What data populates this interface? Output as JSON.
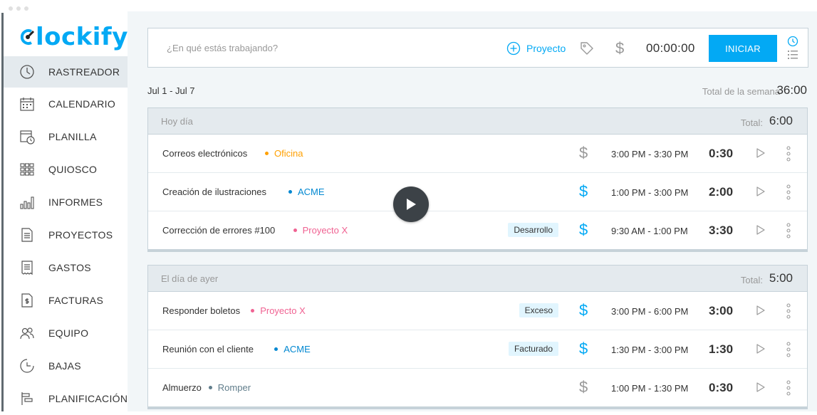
{
  "app": {
    "logo_text": "lockify",
    "brand_color": "#03a9f4"
  },
  "sidebar": {
    "items": [
      {
        "label": "RASTREADOR",
        "icon": "clock-icon",
        "active": true
      },
      {
        "label": "CALENDARIO",
        "icon": "calendar-icon"
      },
      {
        "label": "PLANILLA",
        "icon": "timesheet-icon"
      },
      {
        "label": "QUIOSCO",
        "icon": "kiosk-icon"
      },
      {
        "label": "INFORMES",
        "icon": "reports-icon"
      },
      {
        "label": "PROYECTOS",
        "icon": "projects-icon"
      },
      {
        "label": "GASTOS",
        "icon": "expenses-icon"
      },
      {
        "label": "FACTURAS",
        "icon": "invoices-icon"
      },
      {
        "label": "EQUIPO",
        "icon": "team-icon"
      },
      {
        "label": "BAJAS",
        "icon": "time-off-icon"
      },
      {
        "label": "PLANIFICACIÓN",
        "icon": "schedule-icon"
      }
    ]
  },
  "tracker": {
    "placeholder": "¿En qué estás trabajando?",
    "project_label": "Proyecto",
    "timer": "00:00:00",
    "start_label": "INICIAR"
  },
  "week": {
    "range": "Jul 1 - Jul 7",
    "total_label": "Total de la semana",
    "total_value": "36:00"
  },
  "groups": [
    {
      "title": "Hoy día",
      "total_label": "Total:",
      "total_value": "6:00",
      "entries": [
        {
          "name": "Correos electrónicos",
          "project": "Oficina",
          "project_color": "#ffa000",
          "badge": "",
          "billable": false,
          "range": "3:00 PM - 3:30 PM",
          "duration": "0:30"
        },
        {
          "name": "Creación de ilustraciones",
          "project": "ACME",
          "project_color": "#0288d1",
          "badge": "",
          "billable": true,
          "range": "1:00 PM - 3:00 PM",
          "duration": "2:00"
        },
        {
          "name": "Corrección de errores #100",
          "project": "Proyecto X",
          "project_color": "#f06292",
          "badge": "Desarrollo",
          "billable": true,
          "range": "9:30 AM - 1:00 PM",
          "duration": "3:30"
        }
      ]
    },
    {
      "title": "El día de ayer",
      "total_label": "Total:",
      "total_value": "5:00",
      "entries": [
        {
          "name": "Responder boletos",
          "project": "Proyecto X",
          "project_color": "#f06292",
          "badge": "Exceso",
          "billable": true,
          "range": "3:00 PM - 6:00 PM",
          "duration": "3:00"
        },
        {
          "name": "Reunión con el cliente",
          "project": "ACME",
          "project_color": "#0288d1",
          "badge": "Facturado",
          "billable": true,
          "range": "1:30 PM - 3:00 PM",
          "duration": "1:30"
        },
        {
          "name": "Almuerzo",
          "project": "Romper",
          "project_color": "#607d8b",
          "badge": "",
          "billable": false,
          "range": "1:00 PM - 1:30 PM",
          "duration": "0:30"
        }
      ]
    }
  ]
}
